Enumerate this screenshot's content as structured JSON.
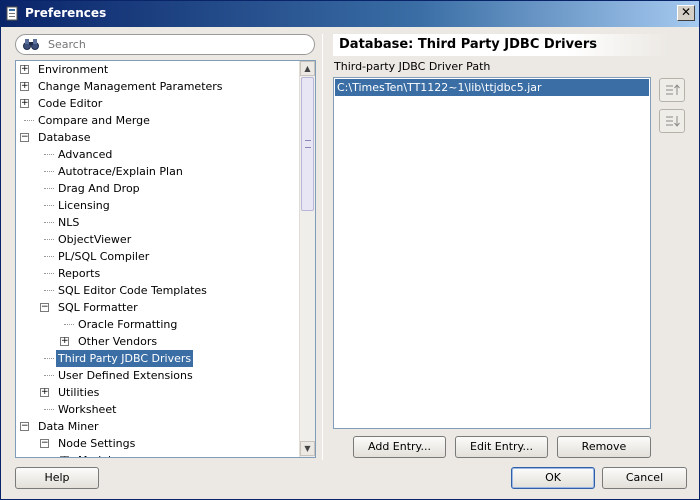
{
  "window": {
    "title": "Preferences",
    "close_glyph": "✕"
  },
  "search": {
    "placeholder": "Search",
    "value": ""
  },
  "tree": {
    "items": [
      {
        "label": "Environment",
        "level": 0,
        "expander": "+"
      },
      {
        "label": "Change Management Parameters",
        "level": 0,
        "expander": "+"
      },
      {
        "label": "Code Editor",
        "level": 0,
        "expander": "+"
      },
      {
        "label": "Compare and Merge",
        "level": 0,
        "expander": ""
      },
      {
        "label": "Database",
        "level": 0,
        "expander": "−"
      },
      {
        "label": "Advanced",
        "level": 1,
        "expander": ""
      },
      {
        "label": "Autotrace/Explain Plan",
        "level": 1,
        "expander": ""
      },
      {
        "label": "Drag And Drop",
        "level": 1,
        "expander": ""
      },
      {
        "label": "Licensing",
        "level": 1,
        "expander": ""
      },
      {
        "label": "NLS",
        "level": 1,
        "expander": ""
      },
      {
        "label": "ObjectViewer",
        "level": 1,
        "expander": ""
      },
      {
        "label": "PL/SQL Compiler",
        "level": 1,
        "expander": ""
      },
      {
        "label": "Reports",
        "level": 1,
        "expander": ""
      },
      {
        "label": "SQL Editor Code Templates",
        "level": 1,
        "expander": ""
      },
      {
        "label": "SQL Formatter",
        "level": 1,
        "expander": "−"
      },
      {
        "label": "Oracle Formatting",
        "level": 2,
        "expander": ""
      },
      {
        "label": "Other Vendors",
        "level": 2,
        "expander": "+"
      },
      {
        "label": "Third Party JDBC Drivers",
        "level": 1,
        "expander": "",
        "selected": true
      },
      {
        "label": "User Defined Extensions",
        "level": 1,
        "expander": ""
      },
      {
        "label": "Utilities",
        "level": 1,
        "expander": "+"
      },
      {
        "label": "Worksheet",
        "level": 1,
        "expander": ""
      },
      {
        "label": "Data Miner",
        "level": 0,
        "expander": "−"
      },
      {
        "label": "Node Settings",
        "level": 1,
        "expander": "−"
      },
      {
        "label": "Model",
        "level": 2,
        "expander": "+"
      }
    ]
  },
  "panel": {
    "title": "Database: Third Party JDBC Drivers",
    "path_label": "Third-party JDBC Driver Path",
    "drivers": [
      "C:\\TimesTen\\TT1122~1\\lib\\ttjdbc5.jar"
    ]
  },
  "buttons": {
    "add_entry": "Add Entry...",
    "edit_entry": "Edit Entry...",
    "remove": "Remove",
    "help": "Help",
    "ok": "OK",
    "cancel": "Cancel"
  },
  "colors": {
    "selection": "#3a6ea5",
    "title_bar": "#0a246a"
  }
}
